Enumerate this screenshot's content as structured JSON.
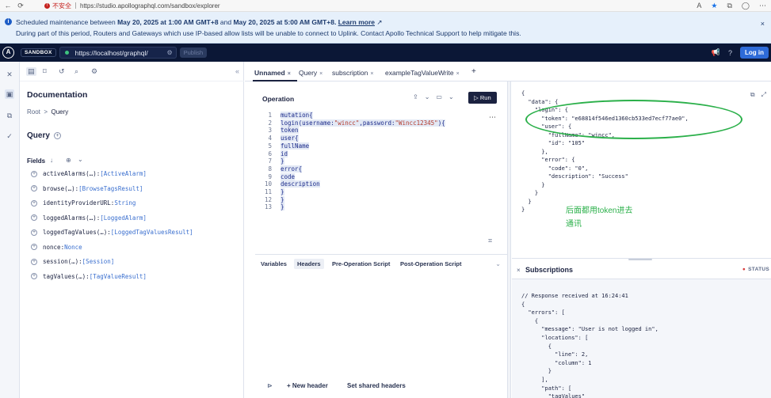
{
  "browser": {
    "back": "←",
    "reload": "⟳",
    "insecure_label": "不安全",
    "url": "https://studio.apollographql.com/sandbox/explorer",
    "icons": [
      "font-size-icon",
      "star-icon",
      "extensions-icon",
      "profile-icon",
      "menu-icon"
    ]
  },
  "banner": {
    "line1_pre": "Scheduled maintenance between ",
    "line1_b1": "May 20, 2025 at 1:00 AM GMT+8",
    "line1_mid": " and ",
    "line1_b2": "May 20, 2025 at 5:00 AM GMT+8.",
    "learn_more": "Learn more",
    "line2": "During part of this period, Routers and Gateways which use IP-based allow lists will be unable to connect to Uplink. Contact Apollo Technical Support to help mitigate this.",
    "close": "×"
  },
  "header": {
    "sandbox": "SANDBOX",
    "endpoint": "https://localhost/graphql/",
    "publish": "Publish",
    "login": "Log in"
  },
  "docs": {
    "collapse": "«",
    "title": "Documentation",
    "crumb_root": "Root",
    "crumb_sep": ">",
    "crumb_current": "Query",
    "query_heading": "Query",
    "fields_heading": "Fields",
    "fields": [
      {
        "name": "activeAlarms(…): ",
        "type": "[ActiveAlarm]"
      },
      {
        "name": "browse(…): ",
        "type": "[BrowseTagsResult]"
      },
      {
        "name": "identityProviderURL: ",
        "type": "String"
      },
      {
        "name": "loggedAlarms(…): ",
        "type": "[LoggedAlarm]"
      },
      {
        "name": "loggedTagValues(…): ",
        "type": "[LoggedTagValuesResult]"
      },
      {
        "name": "nonce: ",
        "type": "Nonce"
      },
      {
        "name": "session(…): ",
        "type": "[Session]"
      },
      {
        "name": "tagValues(…): ",
        "type": "[TagValueResult]"
      }
    ]
  },
  "tabs": [
    {
      "label": "Unnamed"
    },
    {
      "label": "Query"
    },
    {
      "label": "subscription"
    },
    {
      "label": "exampleTagValueWrite"
    }
  ],
  "tab_close": "×",
  "tab_add": "+",
  "operation": {
    "title": "Operation",
    "run": "Run",
    "line_numbers": "1\n2\n3\n4\n5\n6\n7\n8\n9\n10\n11\n12\n13",
    "lines": [
      "mutation{",
      "login(username:\"wincc\",password:\"Wincc12345\"){",
      "token",
      "user{",
      "fullName",
      "id",
      "}",
      "error{",
      "code",
      "description",
      "}",
      "}",
      "}"
    ]
  },
  "vars": {
    "tabs": [
      "Variables",
      "Headers",
      "Pre-Operation Script",
      "Post-Operation Script"
    ],
    "new_header": "+ New header",
    "shared_headers": "Set shared headers"
  },
  "response": {
    "code": "{\n  \"data\": {\n    \"login\": {\n      \"token\": \"e68814f546ed1360cb533ed7ecf77ae0\",\n      \"user\": {\n        \"fullName\": \"wincc\",\n        \"id\": \"105\"\n      },\n      \"error\": {\n        \"code\": \"0\",\n        \"description\": \"Success\"\n      }\n    }\n  }\n}",
    "annotation": "后面都用token进去通讯"
  },
  "subscriptions": {
    "close": "×",
    "title": "Subscriptions",
    "status": "STATUS",
    "code": "// Response received at 16:24:41\n{\n  \"errors\": [\n    {\n      \"message\": \"User is not logged in\",\n      \"locations\": [\n        {\n          \"line\": 2,\n          \"column\": 1\n        }\n      ],\n      \"path\": [\n        \"tagValues\"\n      ]"
  },
  "colors": {
    "header_bg": "#0b1736",
    "run_button": "#1b2240",
    "login_button": "#2e6bd8",
    "annotation": "#2bb04a",
    "status_dot": "#3ec37f"
  }
}
